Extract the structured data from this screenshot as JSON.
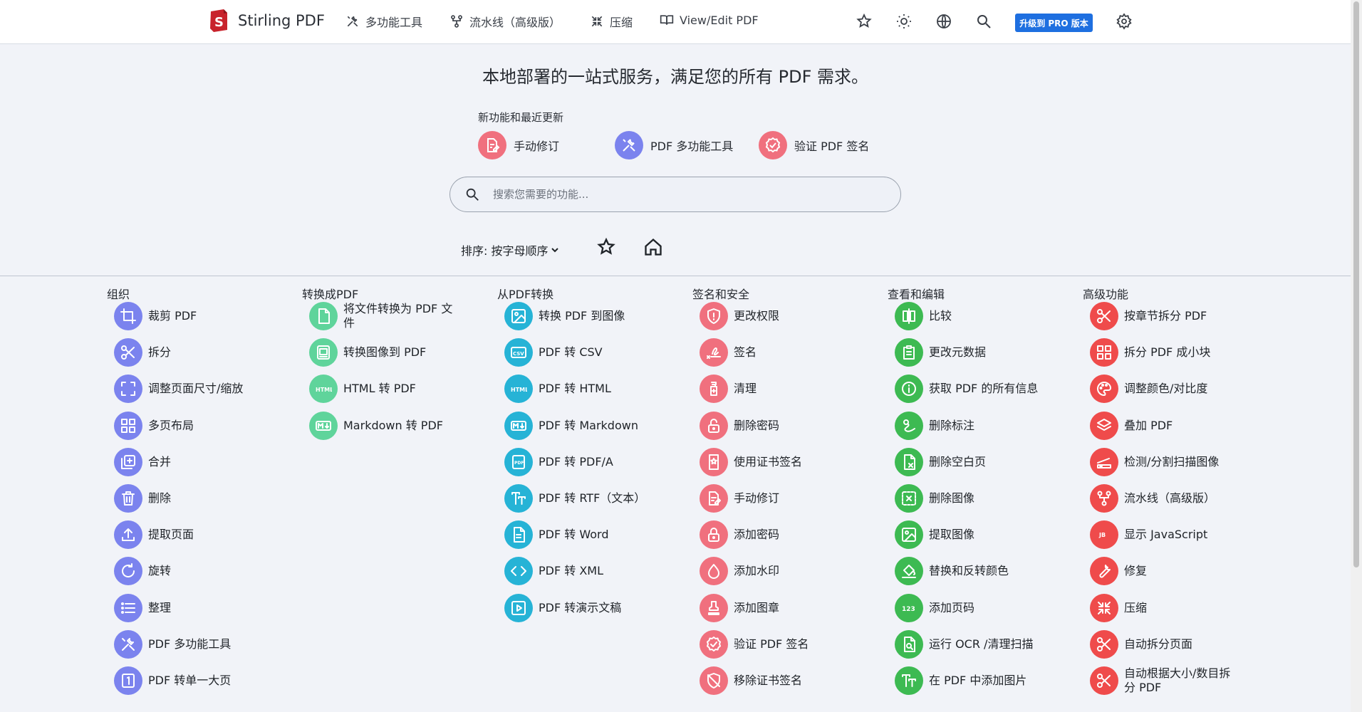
{
  "nav": {
    "brand": "Stirling PDF",
    "items": [
      "多功能工具",
      "流水线（高级版）",
      "压缩",
      "View/Edit PDF"
    ],
    "pro_button": "升级到 PRO 版本"
  },
  "hero": {
    "tagline": "本地部署的一站式服务，满足您的所有 PDF 需求。",
    "recent_title": "新功能和最近更新",
    "recent_items": [
      "手动修订",
      "PDF 多功能工具",
      "验证 PDF 签名"
    ],
    "search_placeholder": "搜索您需要的功能...",
    "sort_label": "排序: 按字母顺序"
  },
  "colors": {
    "organize": "#7b83ee",
    "convert_to": "#5fd49b",
    "convert_from": "#26b3d6",
    "security": "#f0707e",
    "view_edit": "#3dba52",
    "advanced": "#ef4b4b"
  },
  "columns": [
    {
      "title": "组织",
      "color_key": "organize",
      "tools": [
        {
          "label": "裁剪 PDF",
          "icon": "crop-icon"
        },
        {
          "label": "拆分",
          "icon": "scissors-icon"
        },
        {
          "label": "调整页面尺寸/缩放",
          "icon": "expand-icon"
        },
        {
          "label": "多页布局",
          "icon": "grid-icon"
        },
        {
          "label": "合并",
          "icon": "merge-icon"
        },
        {
          "label": "删除",
          "icon": "trash-icon"
        },
        {
          "label": "提取页面",
          "icon": "upload-icon"
        },
        {
          "label": "旋转",
          "icon": "rotate-icon"
        },
        {
          "label": "整理",
          "icon": "list-icon"
        },
        {
          "label": "PDF 多功能工具",
          "icon": "tools-icon"
        },
        {
          "label": "PDF 转单一大页",
          "icon": "single-page-icon"
        }
      ]
    },
    {
      "title": "转换成PDF",
      "color_key": "convert_to",
      "tools": [
        {
          "label": "将文件转换为 PDF 文件",
          "icon": "file-icon"
        },
        {
          "label": "转换图像到 PDF",
          "icon": "pdf-image-icon"
        },
        {
          "label": "HTML 转 PDF",
          "icon": "html-icon"
        },
        {
          "label": "Markdown 转 PDF",
          "icon": "markdown-icon"
        }
      ]
    },
    {
      "title": "从PDF转换",
      "color_key": "convert_from",
      "tools": [
        {
          "label": "转换 PDF 到图像",
          "icon": "image-icon"
        },
        {
          "label": "PDF 转 CSV",
          "icon": "csv-icon"
        },
        {
          "label": "PDF 转 HTML",
          "icon": "html-icon"
        },
        {
          "label": "PDF 转 Markdown",
          "icon": "markdown-icon"
        },
        {
          "label": "PDF 转 PDF/A",
          "icon": "pdfa-icon"
        },
        {
          "label": "PDF 转 RTF（文本）",
          "icon": "text-icon"
        },
        {
          "label": "PDF 转 Word",
          "icon": "document-icon"
        },
        {
          "label": "PDF 转 XML",
          "icon": "code-icon"
        },
        {
          "label": "PDF 转演示文稿",
          "icon": "slides-icon"
        }
      ]
    },
    {
      "title": "签名和安全",
      "color_key": "security",
      "tools": [
        {
          "label": "更改权限",
          "icon": "shield-icon"
        },
        {
          "label": "签名",
          "icon": "signature-icon"
        },
        {
          "label": "清理",
          "icon": "sanitize-icon"
        },
        {
          "label": "删除密码",
          "icon": "unlock-icon"
        },
        {
          "label": "使用证书签名",
          "icon": "certificate-icon"
        },
        {
          "label": "手动修订",
          "icon": "redact-icon"
        },
        {
          "label": "添加密码",
          "icon": "lock-icon"
        },
        {
          "label": "添加水印",
          "icon": "droplet-icon"
        },
        {
          "label": "添加图章",
          "icon": "stamp-icon"
        },
        {
          "label": "验证 PDF 签名",
          "icon": "verify-icon"
        },
        {
          "label": "移除证书签名",
          "icon": "remove-cert-icon"
        }
      ]
    },
    {
      "title": "查看和编辑",
      "color_key": "view_edit",
      "tools": [
        {
          "label": "比较",
          "icon": "compare-icon"
        },
        {
          "label": "更改元数据",
          "icon": "clipboard-icon"
        },
        {
          "label": "获取 PDF 的所有信息",
          "icon": "info-icon"
        },
        {
          "label": "删除标注",
          "icon": "draw-icon"
        },
        {
          "label": "删除空白页",
          "icon": "blank-page-icon"
        },
        {
          "label": "删除图像",
          "icon": "remove-image-icon"
        },
        {
          "label": "提取图像",
          "icon": "image-icon"
        },
        {
          "label": "替换和反转颜色",
          "icon": "paint-bucket-icon"
        },
        {
          "label": "添加页码",
          "icon": "numbers-icon"
        },
        {
          "label": "运行 OCR /清理扫描",
          "icon": "ocr-icon"
        },
        {
          "label": "在 PDF 中添加图片",
          "icon": "text-icon"
        }
      ]
    },
    {
      "title": "高级功能",
      "color_key": "advanced",
      "tools": [
        {
          "label": "按章节拆分 PDF",
          "icon": "scissors-icon"
        },
        {
          "label": "拆分 PDF 成小块",
          "icon": "grid-icon"
        },
        {
          "label": "调整颜色/对比度",
          "icon": "palette-icon"
        },
        {
          "label": "叠加 PDF",
          "icon": "layers-icon"
        },
        {
          "label": "检测/分割扫描图像",
          "icon": "scanner-icon"
        },
        {
          "label": "流水线（高级版）",
          "icon": "pipeline-icon"
        },
        {
          "label": "显示 JavaScript",
          "icon": "js-icon"
        },
        {
          "label": "修复",
          "icon": "wrench-icon"
        },
        {
          "label": "压缩",
          "icon": "compress-icon"
        },
        {
          "label": "自动拆分页面",
          "icon": "scissors-icon"
        },
        {
          "label": "自动根据大小/数目拆分 PDF",
          "icon": "scissors-icon"
        }
      ]
    }
  ]
}
